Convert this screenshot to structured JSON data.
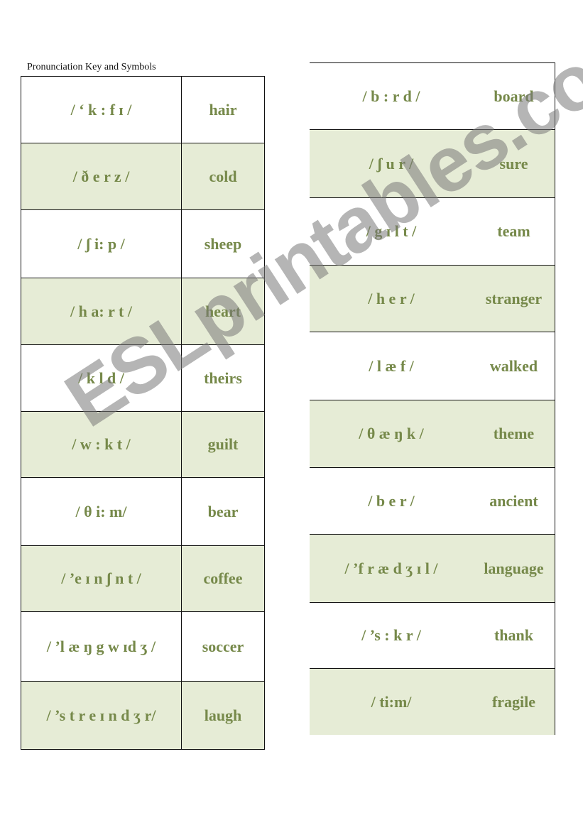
{
  "title": "Pronunciation Key and Symbols",
  "colors": {
    "text": "#76894a",
    "shade": "#e6ecd6"
  },
  "left_rows": [
    {
      "phonetic": "/ ‘ k : f ɪ  /",
      "word": "hair"
    },
    {
      "phonetic": "/ ð e r z /",
      "word": "cold"
    },
    {
      "phonetic": "/ ʃ i: p /",
      "word": "sheep"
    },
    {
      "phonetic": "/ h a: r t /",
      "word": "heart"
    },
    {
      "phonetic": "/ k l d /",
      "word": "theirs"
    },
    {
      "phonetic": "/ w : k t /",
      "word": "guilt"
    },
    {
      "phonetic": "/ θ i: m/",
      "word": "bear"
    },
    {
      "phonetic": "/ ’e ɪ  n ʃ  n t /",
      "word": "coffee"
    },
    {
      "phonetic": "/ ’l æ ŋ g w ɪd ʒ /",
      "word": "soccer"
    },
    {
      "phonetic": "/ ’s t r e ɪ  n d ʒ r/",
      "word": "laugh"
    }
  ],
  "right_rows": [
    {
      "phonetic": "/ b : r d /",
      "word": "board"
    },
    {
      "phonetic": "/ ʃ u r /",
      "word": "sure"
    },
    {
      "phonetic": "/ g ɪ  l t /",
      "word": "team"
    },
    {
      "phonetic": "/ h e r /",
      "word": "stranger"
    },
    {
      "phonetic": "/ l æ f  /",
      "word": "walked"
    },
    {
      "phonetic": "/ θ æ ŋ k /",
      "word": "theme"
    },
    {
      "phonetic": "/ b e r /",
      "word": "ancient"
    },
    {
      "phonetic": "/ ’f  r æ d ʒ ɪ  l /",
      "word": "language"
    },
    {
      "phonetic": "/ ’s : k r /",
      "word": "thank"
    },
    {
      "phonetic": "/ ti:m/",
      "word": "fragile"
    }
  ],
  "watermark": "ESLprintables.com"
}
